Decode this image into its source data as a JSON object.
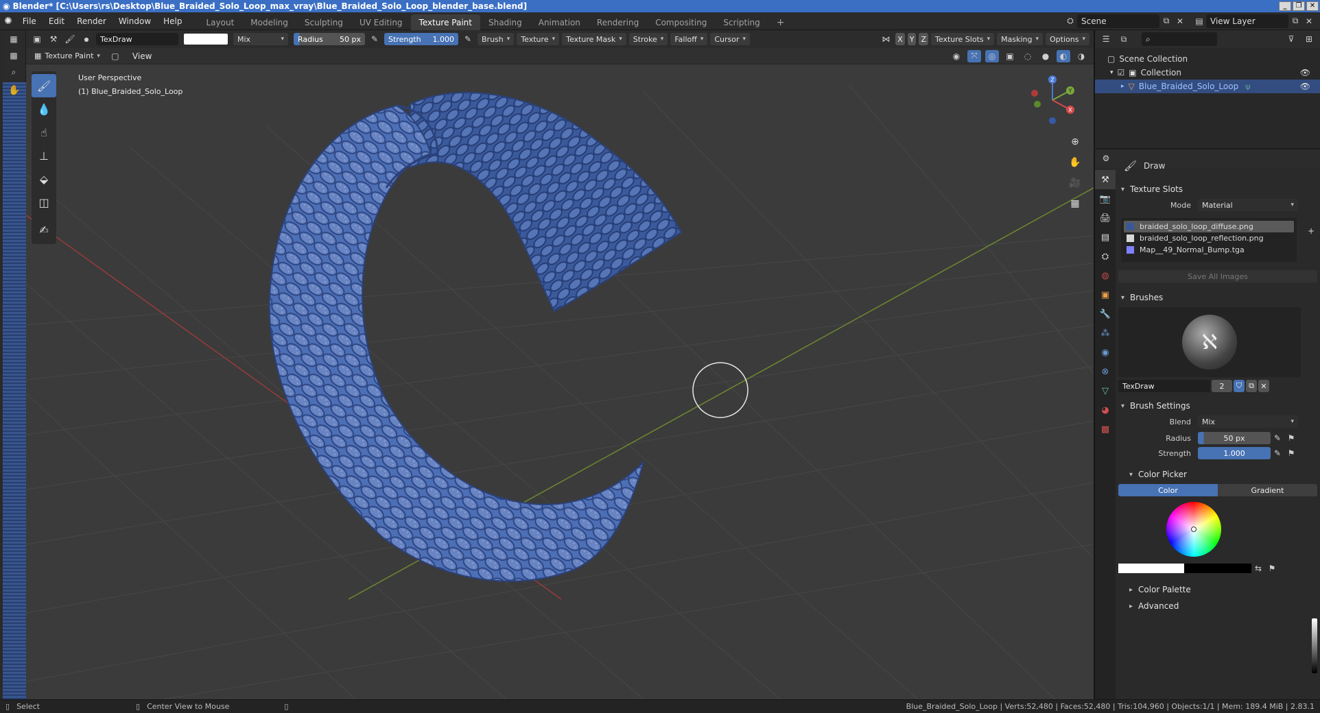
{
  "window": {
    "title": "Blender* [C:\\Users\\rs\\Desktop\\Blue_Braided_Solo_Loop_max_vray\\Blue_Braided_Solo_Loop_blender_base.blend]",
    "min": "_",
    "max": "❐",
    "close": "✕"
  },
  "menus": [
    "File",
    "Edit",
    "Render",
    "Window",
    "Help"
  ],
  "workspaces": [
    {
      "label": "Layout"
    },
    {
      "label": "Modeling"
    },
    {
      "label": "Sculpting"
    },
    {
      "label": "UV Editing"
    },
    {
      "label": "Texture Paint"
    },
    {
      "label": "Shading"
    },
    {
      "label": "Animation"
    },
    {
      "label": "Rendering"
    },
    {
      "label": "Compositing"
    },
    {
      "label": "Scripting"
    }
  ],
  "active_workspace": "Texture Paint",
  "add_tab": "+",
  "scene": {
    "name": "Scene",
    "view_layer": "View Layer"
  },
  "tool_header": {
    "brush_name": "TexDraw",
    "blend": "Mix",
    "radius_label": "Radius",
    "radius_value": "50 px",
    "strength_label": "Strength",
    "strength_value": "1.000",
    "menus": [
      "Brush",
      "Texture",
      "Texture Mask",
      "Stroke",
      "Falloff",
      "Cursor"
    ],
    "axes": [
      "X",
      "Y",
      "Z"
    ],
    "right_menus": [
      "Texture Slots",
      "Masking",
      "Options"
    ]
  },
  "view_header": {
    "mode": "Texture Paint",
    "view": "View"
  },
  "viewport_info": {
    "line1": "User Perspective",
    "line2": "(1) Blue_Braided_Solo_Loop"
  },
  "gizmo": {
    "x": "X",
    "y": "Y",
    "z": "Z"
  },
  "outliner": {
    "search_placeholder": "",
    "scene_collection": "Scene Collection",
    "collection": "Collection",
    "object": "Blue_Braided_Solo_Loop"
  },
  "properties": {
    "tool_name": "Draw",
    "texture_slots": {
      "title": "Texture Slots",
      "mode_label": "Mode",
      "mode_value": "Material",
      "slots": [
        {
          "name": "braided_solo_loop_diffuse.png",
          "color": "#3a5898"
        },
        {
          "name": "braided_solo_loop_reflection.png",
          "color": "#d8d8d8"
        },
        {
          "name": "Map__49_Normal_Bump.tga",
          "color": "#8080ff"
        }
      ],
      "save_all": "Save All Images"
    },
    "brushes": {
      "title": "Brushes",
      "name": "TexDraw",
      "users": "2"
    },
    "brush_settings": {
      "title": "Brush Settings",
      "blend_label": "Blend",
      "blend_value": "Mix",
      "radius_label": "Radius",
      "radius_value": "50 px",
      "strength_label": "Strength",
      "strength_value": "1.000"
    },
    "color_picker": {
      "title": "Color Picker",
      "tab_color": "Color",
      "tab_gradient": "Gradient"
    },
    "color_palette": "Color Palette",
    "advanced": "Advanced"
  },
  "status": {
    "select": "Select",
    "center_view": "Center View to Mouse",
    "stats": "Blue_Braided_Solo_Loop | Verts:52,480 | Faces:52,480 | Tris:104,960 | Objects:1/1 | Mem: 189.4 MiB | 2.83.1"
  },
  "colors": {
    "accent": "#4772b3",
    "title_bar": "#3a6fc4",
    "mesh": "#4a6bb0"
  }
}
